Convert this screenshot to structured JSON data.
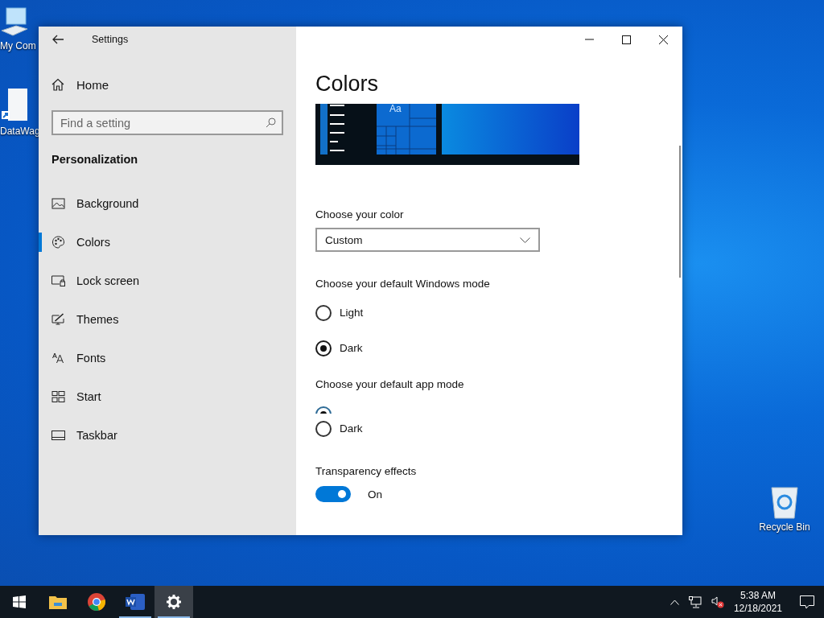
{
  "desktop_icons": [
    {
      "label": "My Com"
    },
    {
      "label": "DataWag"
    },
    {
      "label": "Recycle Bin"
    }
  ],
  "window": {
    "title": "Settings"
  },
  "sidebar": {
    "home": "Home",
    "search": {
      "placeholder": "Find a setting"
    },
    "section": "Personalization",
    "items": [
      {
        "label": "Background",
        "selected": false
      },
      {
        "label": "Colors",
        "selected": true
      },
      {
        "label": "Lock screen",
        "selected": false
      },
      {
        "label": "Themes",
        "selected": false
      },
      {
        "label": "Fonts",
        "selected": false
      },
      {
        "label": "Start",
        "selected": false
      },
      {
        "label": "Taskbar",
        "selected": false
      }
    ]
  },
  "content": {
    "heading": "Colors",
    "preview": {
      "sample_text": "Aa"
    },
    "color_label": "Choose your color",
    "color_value": "Custom",
    "windows_mode": {
      "label": "Choose your default Windows mode",
      "options": [
        {
          "label": "Light",
          "selected": false
        },
        {
          "label": "Dark",
          "selected": true
        }
      ]
    },
    "app_mode": {
      "label": "Choose your default app mode",
      "options": [
        {
          "selected": true
        },
        {
          "label": "Dark",
          "selected": false
        }
      ]
    },
    "transparency": {
      "label": "Transparency effects",
      "on": true,
      "state_text": "On"
    }
  },
  "taskbar": {
    "apps": [
      {
        "running": false,
        "selected": false
      },
      {
        "running": false,
        "selected": false
      },
      {
        "running": false,
        "selected": false
      },
      {
        "running": true,
        "selected": false
      },
      {
        "running": true,
        "selected": true
      }
    ],
    "time": "5:38 AM",
    "date": "12/18/2021"
  }
}
